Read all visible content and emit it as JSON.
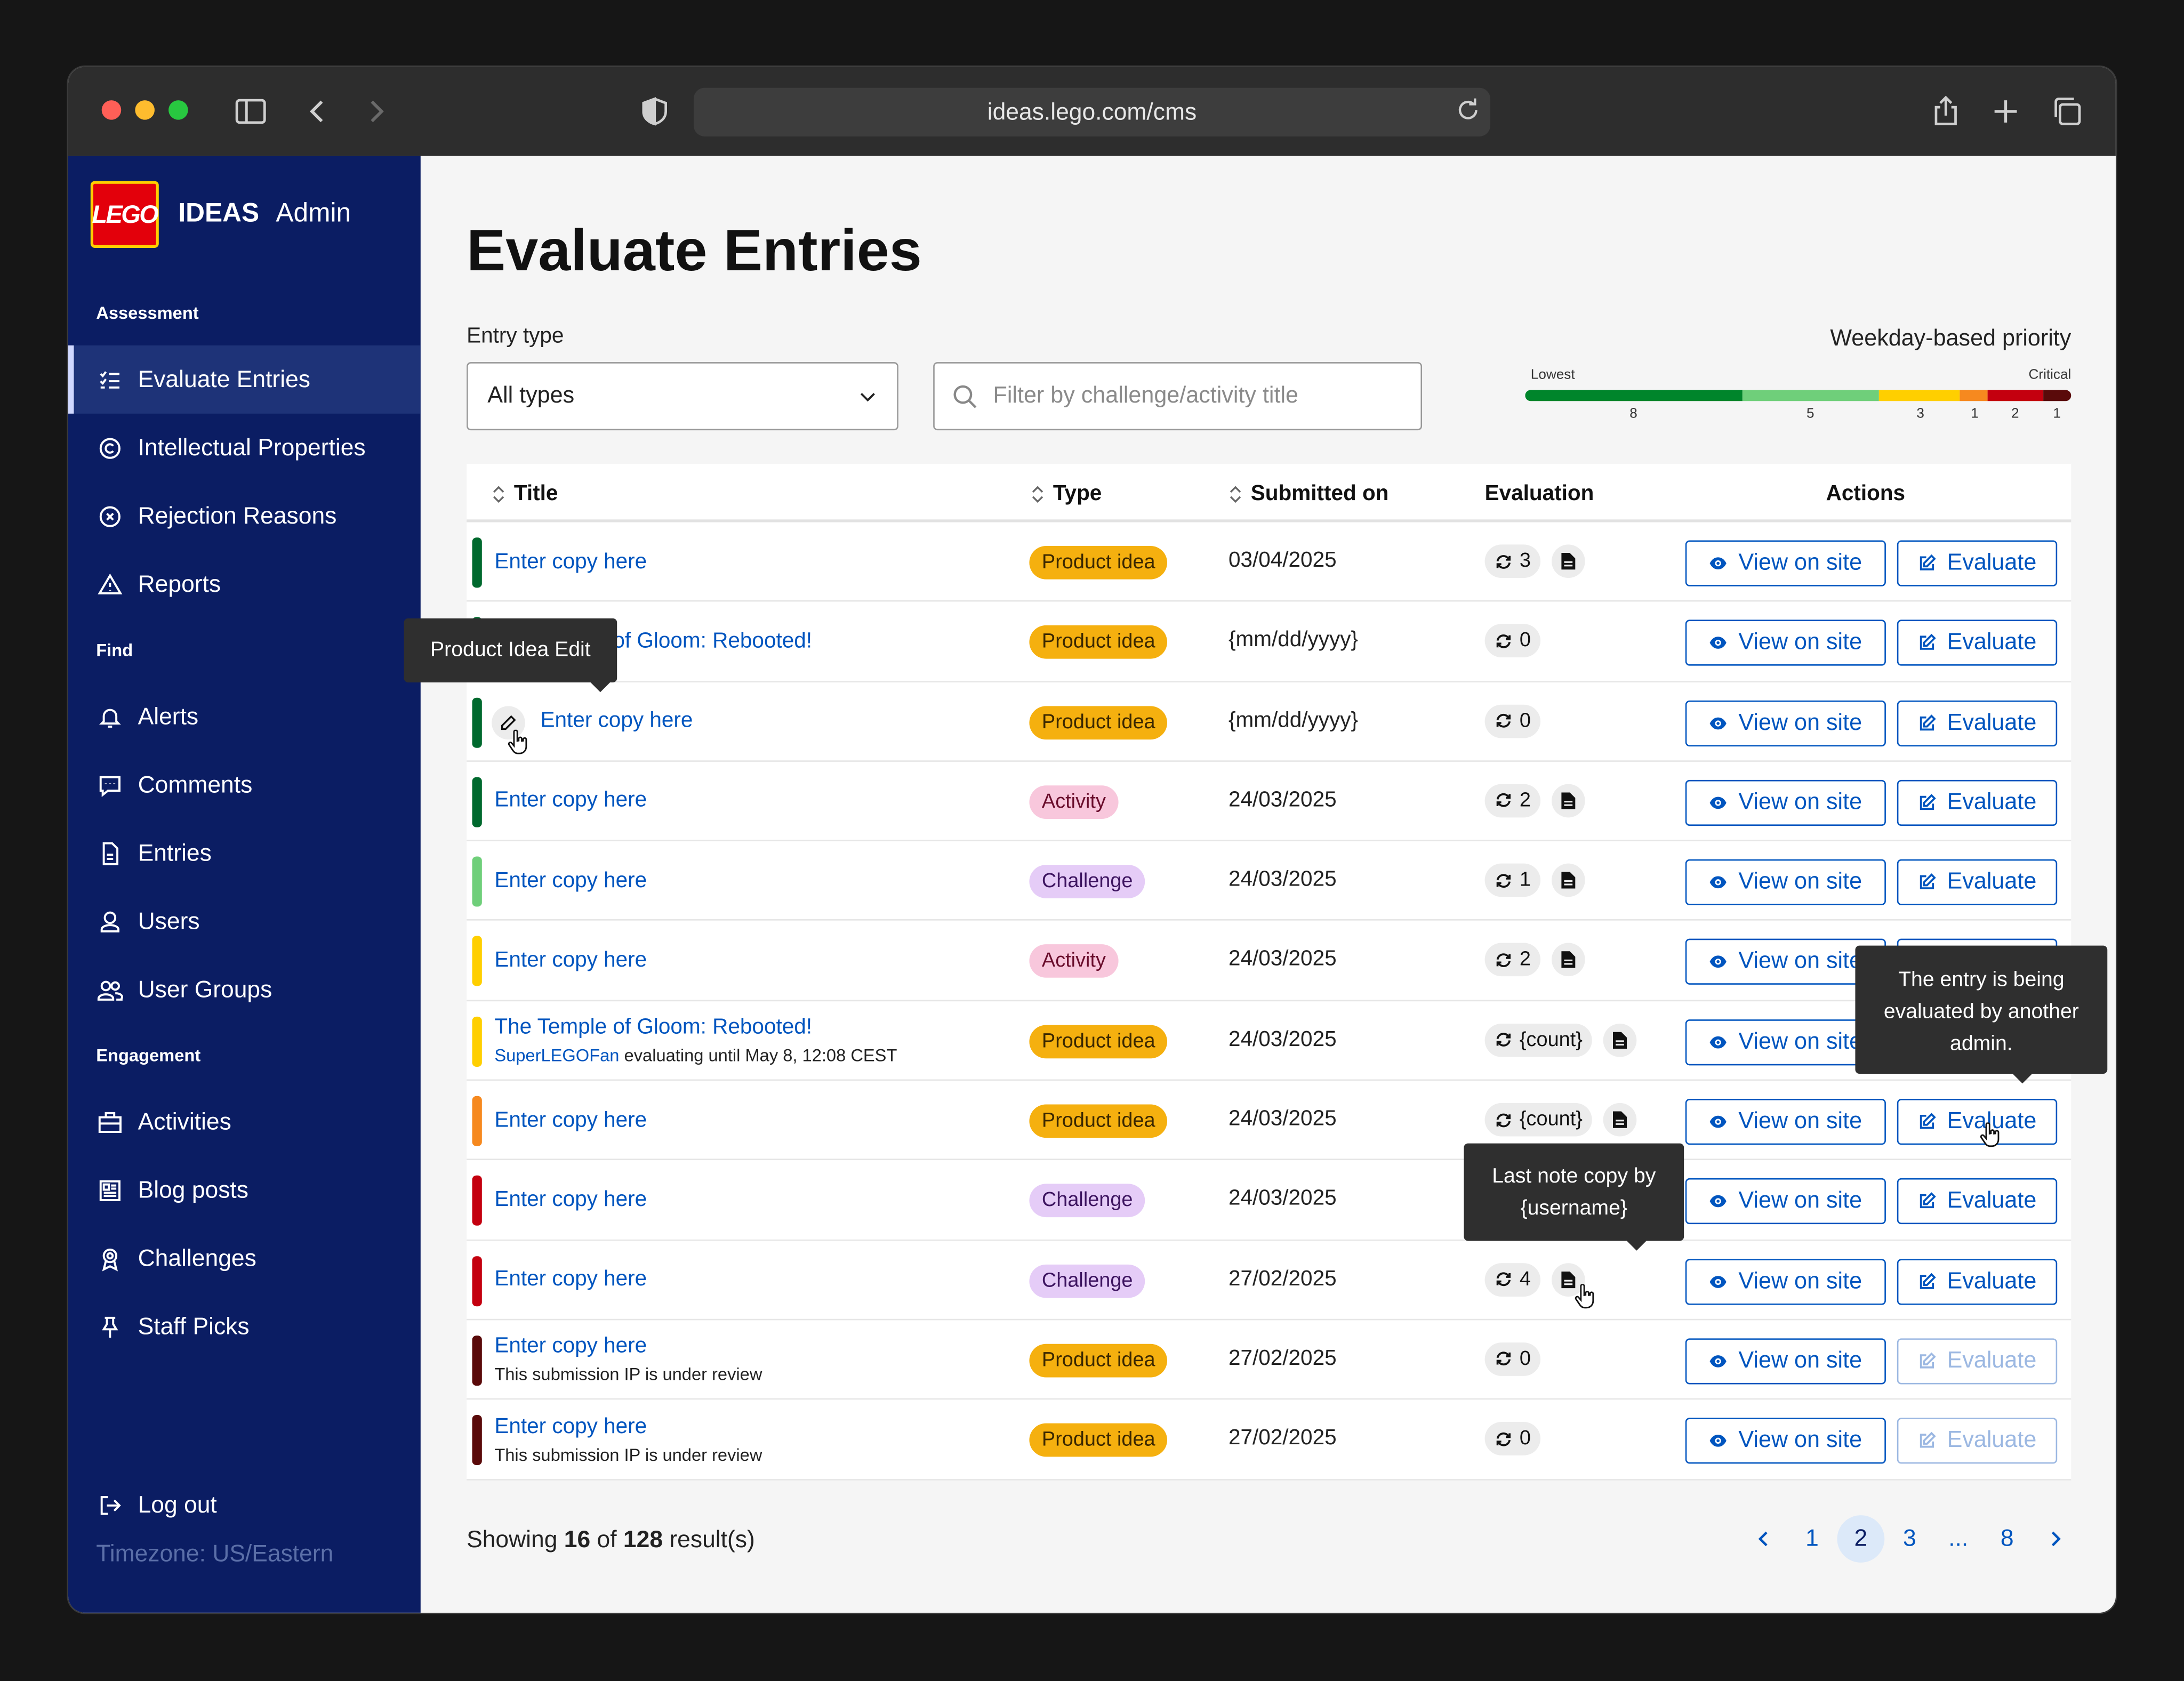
{
  "browser": {
    "url": "ideas.lego.com/cms"
  },
  "sidebar": {
    "logo_text": "LEGO",
    "brand": "IDEAS",
    "admin": "Admin",
    "sections": [
      "Assessment",
      "Find",
      "Engagement"
    ],
    "items": [
      {
        "label": "Evaluate Entries",
        "icon": "checklist-icon"
      },
      {
        "label": "Intellectual Properties",
        "icon": "copyright-icon"
      },
      {
        "label": "Rejection Reasons",
        "icon": "close-circle-icon"
      },
      {
        "label": "Reports",
        "icon": "warning-icon"
      },
      {
        "label": "Alerts",
        "icon": "bell-icon"
      },
      {
        "label": "Comments",
        "icon": "comment-icon"
      },
      {
        "label": "Entries",
        "icon": "document-icon"
      },
      {
        "label": "Users",
        "icon": "user-icon"
      },
      {
        "label": "User Groups",
        "icon": "users-icon"
      },
      {
        "label": "Activities",
        "icon": "briefcase-icon"
      },
      {
        "label": "Blog posts",
        "icon": "newspaper-icon"
      },
      {
        "label": "Challenges",
        "icon": "badge-icon"
      },
      {
        "label": "Staff Picks",
        "icon": "pin-icon"
      }
    ],
    "logout": "Log out",
    "timezone": "Timezone: US/Eastern"
  },
  "page": {
    "title": "Evaluate Entries",
    "entry_type_label": "Entry type",
    "entry_type_value": "All types",
    "search_placeholder": "Filter by challenge/activity title",
    "priority": {
      "title": "Weekday-based priority",
      "low": "Lowest",
      "high": "Critical",
      "ticks": [
        "8",
        "5",
        "3",
        "1",
        "2",
        "1"
      ],
      "colors": [
        "#00852b",
        "#6fcf7a",
        "#ffcf00",
        "#f6891f",
        "#c4000f",
        "#5a0a0a"
      ]
    },
    "columns": {
      "title": "Title",
      "type": "Type",
      "submitted": "Submitted on",
      "evaluation": "Evaluation",
      "actions": "Actions"
    },
    "view_label": "View on site",
    "evaluate_label": "Evaluate"
  },
  "rows": [
    {
      "stripe": "#00692e",
      "title": "Enter copy here",
      "sub_user": "",
      "sub_text": "",
      "type": "Product idea",
      "date": "03/04/2025",
      "count": "3",
      "note": true,
      "eval_enabled": true
    },
    {
      "stripe": "#00692e",
      "title": "The Temple of Gloom: Rebooted!",
      "sub_user": "",
      "sub_text": "",
      "type": "Product idea",
      "date": "{mm/dd/yyyy}",
      "count": "0",
      "note": false,
      "eval_enabled": true
    },
    {
      "stripe": "#00692e",
      "title": "Enter copy here",
      "sub_user": "",
      "sub_text": "",
      "type": "Product idea",
      "date": "{mm/dd/yyyy}",
      "count": "0",
      "note": false,
      "eval_enabled": true
    },
    {
      "stripe": "#00692e",
      "title": "Enter copy here",
      "sub_user": "",
      "sub_text": "",
      "type": "Activity",
      "date": "24/03/2025",
      "count": "2",
      "note": true,
      "eval_enabled": true
    },
    {
      "stripe": "#6fcf7a",
      "title": "Enter copy here",
      "sub_user": "",
      "sub_text": "",
      "type": "Challenge",
      "date": "24/03/2025",
      "count": "1",
      "note": true,
      "eval_enabled": true
    },
    {
      "stripe": "#ffcf00",
      "title": "Enter copy here",
      "sub_user": "",
      "sub_text": "",
      "type": "Activity",
      "date": "24/03/2025",
      "count": "2",
      "note": true,
      "eval_enabled": true
    },
    {
      "stripe": "#ffcf00",
      "title": "The Temple of Gloom: Rebooted!",
      "sub_user": "SuperLEGOFan",
      "sub_text": " evaluating until May 8, 12:08 CEST",
      "type": "Product idea",
      "date": "24/03/2025",
      "count": "{count}",
      "note": true,
      "eval_enabled": true
    },
    {
      "stripe": "#f6891f",
      "title": "Enter copy here",
      "sub_user": "",
      "sub_text": "",
      "type": "Product idea",
      "date": "24/03/2025",
      "count": "{count}",
      "note": true,
      "eval_enabled": true
    },
    {
      "stripe": "#c4000f",
      "title": "Enter copy here",
      "sub_user": "",
      "sub_text": "",
      "type": "Challenge",
      "date": "24/03/2025",
      "count": "",
      "note": false,
      "eval_enabled": true
    },
    {
      "stripe": "#c4000f",
      "title": "Enter copy here",
      "sub_user": "",
      "sub_text": "",
      "type": "Challenge",
      "date": "27/02/2025",
      "count": "4",
      "note": true,
      "eval_enabled": true
    },
    {
      "stripe": "#5a0a0a",
      "title": "Enter copy here",
      "sub_user": "",
      "sub_text": "This submission IP is under review",
      "type": "Product idea",
      "date": "27/02/2025",
      "count": "0",
      "note": false,
      "eval_enabled": false
    },
    {
      "stripe": "#5a0a0a",
      "title": "Enter copy here",
      "sub_user": "",
      "sub_text": "This submission IP is under review",
      "type": "Product idea",
      "date": "27/02/2025",
      "count": "0",
      "note": false,
      "eval_enabled": false
    }
  ],
  "footer": {
    "showing_prefix": "Showing ",
    "shown": "16",
    "of": " of ",
    "total": "128",
    "suffix": " result(s)"
  },
  "pagination": [
    "1",
    "2",
    "3",
    "...",
    "8"
  ],
  "pagination_current": "2",
  "tooltips": {
    "edit": "Product Idea Edit",
    "evaluating": "The entry is being evaluated by another admin.",
    "note": "Last note copy by {username}"
  }
}
